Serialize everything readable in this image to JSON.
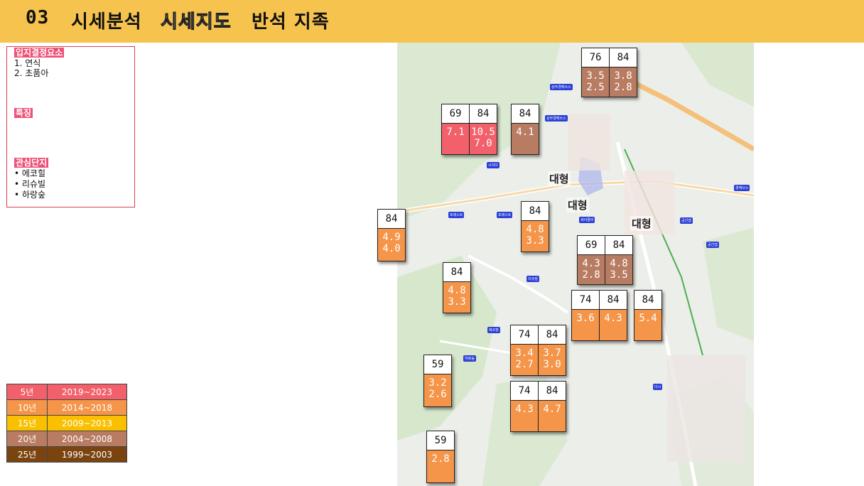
{
  "header": {
    "number": "03",
    "title1": "시세분석",
    "title2": "시세지도",
    "title3": "반석 지족"
  },
  "info": {
    "location_factors": {
      "title": "입지결정요소",
      "items": [
        "1.  연식",
        "2.  초품아"
      ]
    },
    "features": {
      "title": "특징"
    },
    "interest": {
      "title": "관심단지",
      "items": [
        "•  에코힐",
        "•  리슈빌",
        "•  하랑숲"
      ]
    }
  },
  "legend": [
    {
      "age": "5년",
      "years": "2019~2023",
      "color": "#f2616b"
    },
    {
      "age": "10년",
      "years": "2014~2018",
      "color": "#f59549"
    },
    {
      "age": "15년",
      "years": "2009~2013",
      "color": "#fac000"
    },
    {
      "age": "20년",
      "years": "2004~2008",
      "color": "#b87c62"
    },
    {
      "age": "25년",
      "years": "1999~2003",
      "color": "#7a4411"
    }
  ],
  "map": {
    "labels": {
      "big1": "대형",
      "big2": "대형",
      "big3": "대형"
    },
    "tags": [
      "상무경케쓰스",
      "상무경케쓰스",
      "시이다",
      "포레스트",
      "포레스트",
      "세이클리",
      "리슈빌",
      "에코힐",
      "하랑숲",
      "공간앱",
      "공간앱",
      "다시",
      "경케쓰스"
    ]
  },
  "boxes": [
    {
      "id": "b1",
      "color": "#b87c62",
      "cols": [
        {
          "size": "76",
          "v1": "3.5",
          "v2": "2.5"
        },
        {
          "size": "84",
          "v1": "3.8",
          "v2": "2.8"
        }
      ]
    },
    {
      "id": "b2",
      "color": "#f2616b",
      "cols": [
        {
          "size": "69",
          "v1": "7.1",
          "v2": ""
        },
        {
          "size": "84",
          "v1": "10.5",
          "v2": "7.0"
        }
      ]
    },
    {
      "id": "b3",
      "color": "#b87c62",
      "cols": [
        {
          "size": "84",
          "v1": "4.1",
          "v2": ""
        }
      ]
    },
    {
      "id": "b4",
      "color": "#f59549",
      "cols": [
        {
          "size": "84",
          "v1": "4.9",
          "v2": "4.0"
        }
      ]
    },
    {
      "id": "b5",
      "color": "#f59549",
      "cols": [
        {
          "size": "84",
          "v1": "4.8",
          "v2": "3.3"
        }
      ]
    },
    {
      "id": "b6",
      "color": "#b87c62",
      "cols": [
        {
          "size": "69",
          "v1": "4.3",
          "v2": "2.8"
        },
        {
          "size": "84",
          "v1": "4.8",
          "v2": "3.5"
        }
      ]
    },
    {
      "id": "b7",
      "color": "#f59549",
      "cols": [
        {
          "size": "84",
          "v1": "4.8",
          "v2": "3.3"
        }
      ]
    },
    {
      "id": "b8",
      "color": "#f59549",
      "cols": [
        {
          "size": "74",
          "v1": "3.6",
          "v2": ""
        },
        {
          "size": "84",
          "v1": "4.3",
          "v2": ""
        }
      ]
    },
    {
      "id": "b9",
      "color": "#f59549",
      "cols": [
        {
          "size": "84",
          "v1": "5.4",
          "v2": ""
        }
      ]
    },
    {
      "id": "b10",
      "color": "#f59549",
      "cols": [
        {
          "size": "74",
          "v1": "3.4",
          "v2": "2.7"
        },
        {
          "size": "84",
          "v1": "3.7",
          "v2": "3.0"
        }
      ]
    },
    {
      "id": "b11",
      "color": "#f59549",
      "cols": [
        {
          "size": "59",
          "v1": "3.2",
          "v2": "2.6"
        }
      ]
    },
    {
      "id": "b12",
      "color": "#f59549",
      "cols": [
        {
          "size": "74",
          "v1": "4.3",
          "v2": ""
        },
        {
          "size": "84",
          "v1": "4.7",
          "v2": ""
        }
      ]
    },
    {
      "id": "b13",
      "color": "#f59549",
      "cols": [
        {
          "size": "59",
          "v1": "2.8",
          "v2": ""
        }
      ]
    }
  ]
}
